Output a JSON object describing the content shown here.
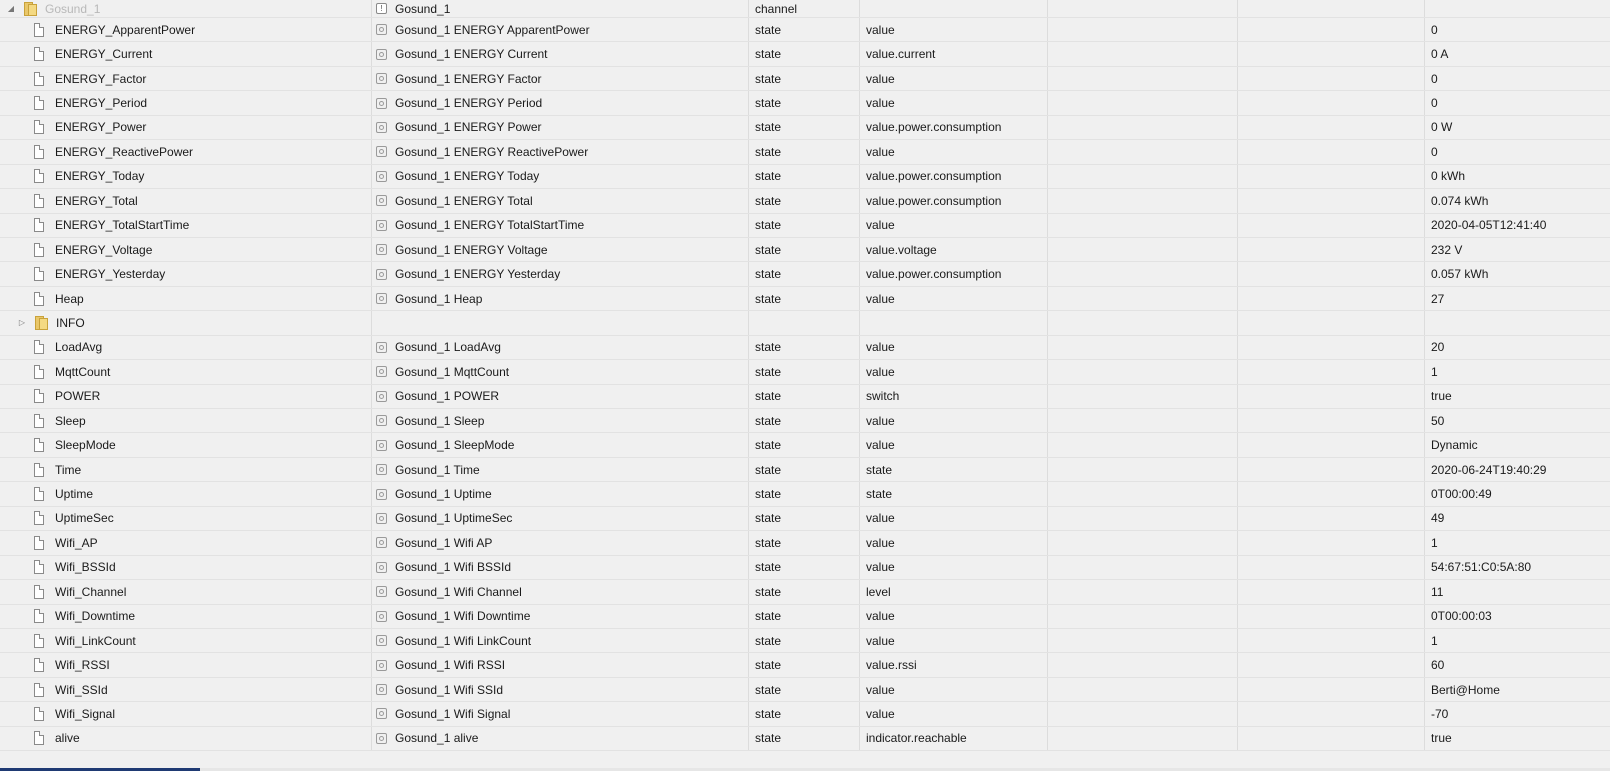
{
  "root": {
    "id": "Gosund_1",
    "name": "Gosund_1",
    "type": "channel"
  },
  "rows": [
    {
      "kind": "state",
      "id": "ENERGY_ApparentPower",
      "name": "Gosund_1 ENERGY ApparentPower",
      "type": "state",
      "role": "value",
      "value": "0"
    },
    {
      "kind": "state",
      "id": "ENERGY_Current",
      "name": "Gosund_1 ENERGY Current",
      "type": "state",
      "role": "value.current",
      "value": "0 A"
    },
    {
      "kind": "state",
      "id": "ENERGY_Factor",
      "name": "Gosund_1 ENERGY Factor",
      "type": "state",
      "role": "value",
      "value": "0"
    },
    {
      "kind": "state",
      "id": "ENERGY_Period",
      "name": "Gosund_1 ENERGY Period",
      "type": "state",
      "role": "value",
      "value": "0"
    },
    {
      "kind": "state",
      "id": "ENERGY_Power",
      "name": "Gosund_1 ENERGY Power",
      "type": "state",
      "role": "value.power.consumption",
      "value": "0 W"
    },
    {
      "kind": "state",
      "id": "ENERGY_ReactivePower",
      "name": "Gosund_1 ENERGY ReactivePower",
      "type": "state",
      "role": "value",
      "value": "0"
    },
    {
      "kind": "state",
      "id": "ENERGY_Today",
      "name": "Gosund_1 ENERGY Today",
      "type": "state",
      "role": "value.power.consumption",
      "value": "0 kWh"
    },
    {
      "kind": "state",
      "id": "ENERGY_Total",
      "name": "Gosund_1 ENERGY Total",
      "type": "state",
      "role": "value.power.consumption",
      "value": "0.074 kWh"
    },
    {
      "kind": "state",
      "id": "ENERGY_TotalStartTime",
      "name": "Gosund_1 ENERGY TotalStartTime",
      "type": "state",
      "role": "value",
      "value": "2020-04-05T12:41:40"
    },
    {
      "kind": "state",
      "id": "ENERGY_Voltage",
      "name": "Gosund_1 ENERGY Voltage",
      "type": "state",
      "role": "value.voltage",
      "value": "232 V"
    },
    {
      "kind": "state",
      "id": "ENERGY_Yesterday",
      "name": "Gosund_1 ENERGY Yesterday",
      "type": "state",
      "role": "value.power.consumption",
      "value": "0.057 kWh"
    },
    {
      "kind": "state",
      "id": "Heap",
      "name": "Gosund_1 Heap",
      "type": "state",
      "role": "value",
      "value": "27"
    },
    {
      "kind": "folder",
      "id": "INFO",
      "name": "",
      "type": "",
      "role": "",
      "value": ""
    },
    {
      "kind": "state",
      "id": "LoadAvg",
      "name": "Gosund_1 LoadAvg",
      "type": "state",
      "role": "value",
      "value": "20"
    },
    {
      "kind": "state",
      "id": "MqttCount",
      "name": "Gosund_1 MqttCount",
      "type": "state",
      "role": "value",
      "value": "1"
    },
    {
      "kind": "state",
      "id": "POWER",
      "name": "Gosund_1 POWER",
      "type": "state",
      "role": "switch",
      "value": "true"
    },
    {
      "kind": "state",
      "id": "Sleep",
      "name": "Gosund_1 Sleep",
      "type": "state",
      "role": "value",
      "value": "50"
    },
    {
      "kind": "state",
      "id": "SleepMode",
      "name": "Gosund_1 SleepMode",
      "type": "state",
      "role": "value",
      "value": "Dynamic"
    },
    {
      "kind": "state",
      "id": "Time",
      "name": "Gosund_1 Time",
      "type": "state",
      "role": "state",
      "value": "2020-06-24T19:40:29"
    },
    {
      "kind": "state",
      "id": "Uptime",
      "name": "Gosund_1 Uptime",
      "type": "state",
      "role": "state",
      "value": "0T00:00:49"
    },
    {
      "kind": "state",
      "id": "UptimeSec",
      "name": "Gosund_1 UptimeSec",
      "type": "state",
      "role": "value",
      "value": "49"
    },
    {
      "kind": "state",
      "id": "Wifi_AP",
      "name": "Gosund_1 Wifi AP",
      "type": "state",
      "role": "value",
      "value": "1"
    },
    {
      "kind": "state",
      "id": "Wifi_BSSId",
      "name": "Gosund_1 Wifi BSSId",
      "type": "state",
      "role": "value",
      "value": "54:67:51:C0:5A:80"
    },
    {
      "kind": "state",
      "id": "Wifi_Channel",
      "name": "Gosund_1 Wifi Channel",
      "type": "state",
      "role": "level",
      "value": "11"
    },
    {
      "kind": "state",
      "id": "Wifi_Downtime",
      "name": "Gosund_1 Wifi Downtime",
      "type": "state",
      "role": "value",
      "value": "0T00:00:03"
    },
    {
      "kind": "state",
      "id": "Wifi_LinkCount",
      "name": "Gosund_1 Wifi LinkCount",
      "type": "state",
      "role": "value",
      "value": "1"
    },
    {
      "kind": "state",
      "id": "Wifi_RSSI",
      "name": "Gosund_1 Wifi RSSI",
      "type": "state",
      "role": "value.rssi",
      "value": "60"
    },
    {
      "kind": "state",
      "id": "Wifi_SSId",
      "name": "Gosund_1 Wifi SSId",
      "type": "state",
      "role": "value",
      "value": "Berti@Home"
    },
    {
      "kind": "state",
      "id": "Wifi_Signal",
      "name": "Gosund_1 Wifi Signal",
      "type": "state",
      "role": "value",
      "value": "-70"
    },
    {
      "kind": "state",
      "id": "alive",
      "name": "Gosund_1 alive",
      "type": "state",
      "role": "indicator.reachable",
      "value": "true"
    }
  ]
}
